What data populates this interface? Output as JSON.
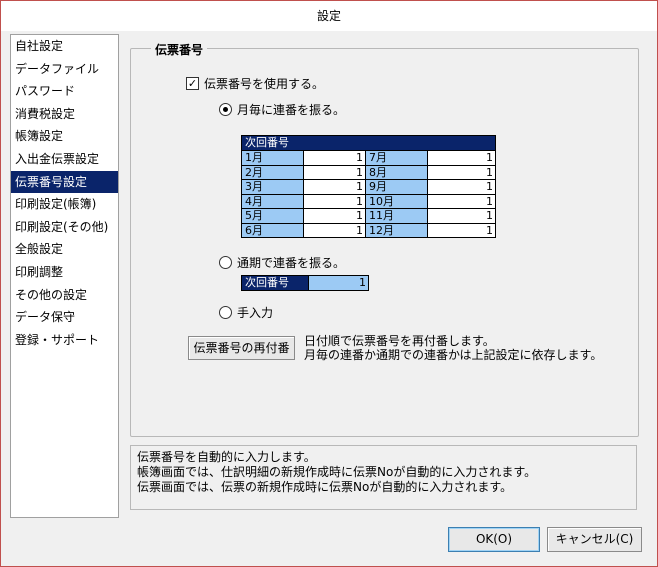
{
  "window": {
    "title": "設定"
  },
  "sidebar": {
    "items": [
      {
        "label": "自社設定"
      },
      {
        "label": "データファイル"
      },
      {
        "label": "パスワード"
      },
      {
        "label": "消費税設定"
      },
      {
        "label": "帳簿設定"
      },
      {
        "label": "入出金伝票設定"
      },
      {
        "label": "伝票番号設定",
        "selected": true
      },
      {
        "label": "印刷設定(帳簿)"
      },
      {
        "label": "印刷設定(その他)"
      },
      {
        "label": "全般設定"
      },
      {
        "label": "印刷調整"
      },
      {
        "label": "その他の設定"
      },
      {
        "label": "データ保守"
      },
      {
        "label": "登録・サポート"
      }
    ]
  },
  "group": {
    "title": "伝票番号",
    "use_number_label": "伝票番号を使用する。",
    "use_number_checked": true,
    "radio_monthly_label": "月毎に連番を振る。",
    "radio_annual_label": "通期で連番を振る。",
    "radio_manual_label": "手入力",
    "selected_mode": "monthly",
    "grid_header": "次回番号",
    "grid_rows": [
      {
        "m1": "1月",
        "v1": "1",
        "m2": "7月",
        "v2": "1"
      },
      {
        "m1": "2月",
        "v1": "1",
        "m2": "8月",
        "v2": "1"
      },
      {
        "m1": "3月",
        "v1": "1",
        "m2": "9月",
        "v2": "1"
      },
      {
        "m1": "4月",
        "v1": "1",
        "m2": "10月",
        "v2": "1"
      },
      {
        "m1": "5月",
        "v1": "1",
        "m2": "11月",
        "v2": "1"
      },
      {
        "m1": "6月",
        "v1": "1",
        "m2": "12月",
        "v2": "1"
      }
    ],
    "annual_label": "次回番号",
    "annual_value": "1",
    "renumber_button": "伝票番号の再付番",
    "renumber_desc1": "日付順で伝票番号を再付番します。",
    "renumber_desc2": "月毎の連番か通期での連番かは上記設定に依存します。"
  },
  "info": {
    "line1": "伝票番号を自動的に入力します。",
    "line2": "帳簿画面では、仕訳明細の新規作成時に伝票Noが自動的に入力されます。",
    "line3": "伝票画面では、伝票の新規作成時に伝票Noが自動的に入力されます。"
  },
  "buttons": {
    "ok": "OK(O)",
    "cancel": "キャンセル(C)"
  }
}
